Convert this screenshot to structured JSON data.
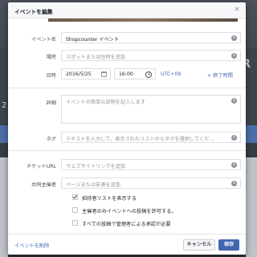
{
  "background": {
    "left_text": "2",
    "right_text": "E R"
  },
  "dialog": {
    "title": "イベントを編集",
    "close_glyph": "×"
  },
  "fields": {
    "event_name": {
      "label": "イベント名",
      "value": "Shopcounter イベント"
    },
    "location": {
      "label": "場所",
      "placeholder": "スポットまたは住所を追加"
    },
    "datetime": {
      "label": "日時",
      "date": "2016/5/25",
      "time": "16:00",
      "timezone": "UTC+09",
      "end_time_link": "+ 終了時間"
    },
    "details": {
      "label": "詳細",
      "placeholder": "イベントの簡単な説明を記入します"
    },
    "tags": {
      "label": "タグ",
      "placeholder": "テキストを入力して、表示されたリストからタグを選択してくだ..."
    },
    "ticket_url": {
      "label": "チケットURL",
      "placeholder": "ウェブサイトリンクを追加"
    },
    "cohosts": {
      "label": "共同主催者",
      "placeholder": "ページまたは友達を追加"
    }
  },
  "checkboxes": [
    {
      "label": "招待者リストを表示する",
      "checked": true
    },
    {
      "label": "主催者のみイベントへの投稿を許可する。",
      "checked": false
    },
    {
      "label": "すべての投稿で管理者による承認が必要",
      "checked": false
    }
  ],
  "footer": {
    "delete_label": "イベントを削除",
    "cancel_label": "キャンセル",
    "save_label": "保存"
  },
  "colors": {
    "accent": "#4267b2",
    "link": "#4267b2",
    "border": "#dddfe2"
  }
}
